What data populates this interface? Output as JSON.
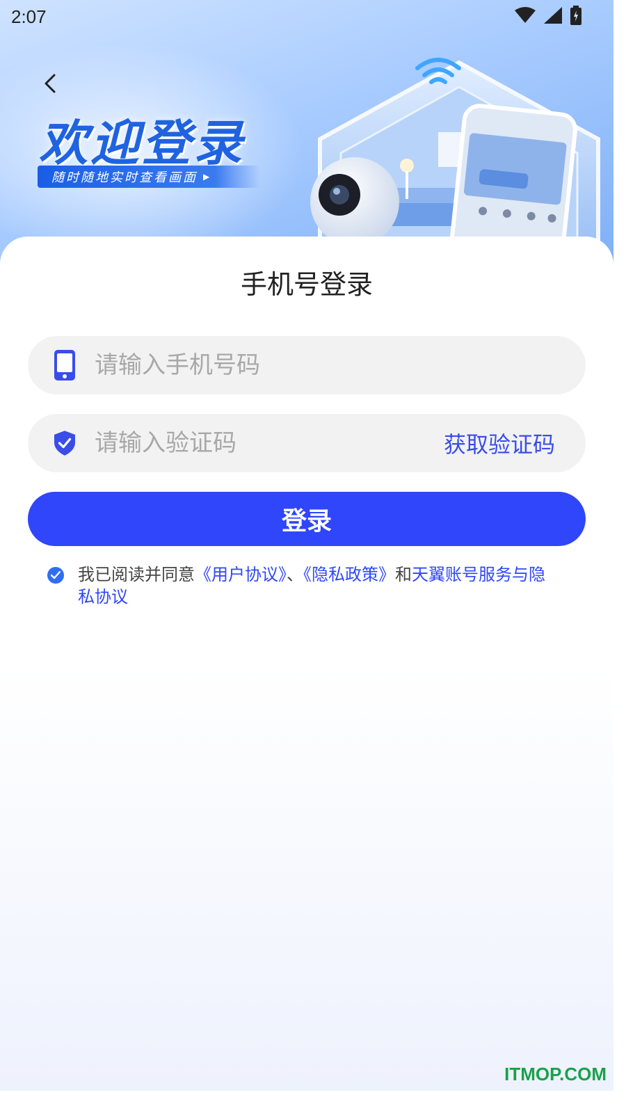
{
  "status_bar": {
    "time": "2:07"
  },
  "header": {
    "title": "欢迎登录",
    "subtitle": "随时随地实时查看画面"
  },
  "login_card": {
    "title": "手机号登录",
    "phone_placeholder": "请输入手机号码",
    "code_placeholder": "请输入验证码",
    "get_code_label": "获取验证码",
    "login_button": "登录"
  },
  "agreement": {
    "prefix": "我已阅读并同意",
    "user_agreement": "《用户协议》",
    "separator": "、",
    "privacy_policy": "《隐私政策》",
    "and": "和",
    "tianyi_agreement": "天翼账号服务与隐私协议",
    "checked": true
  },
  "watermark": "ITMOP.COM",
  "colors": {
    "primary": "#2f46fb",
    "link": "#2f46fb",
    "checkbox": "#2f6ef0",
    "field_bg": "#f2f2f2",
    "title_blue": "#1f63e0"
  }
}
